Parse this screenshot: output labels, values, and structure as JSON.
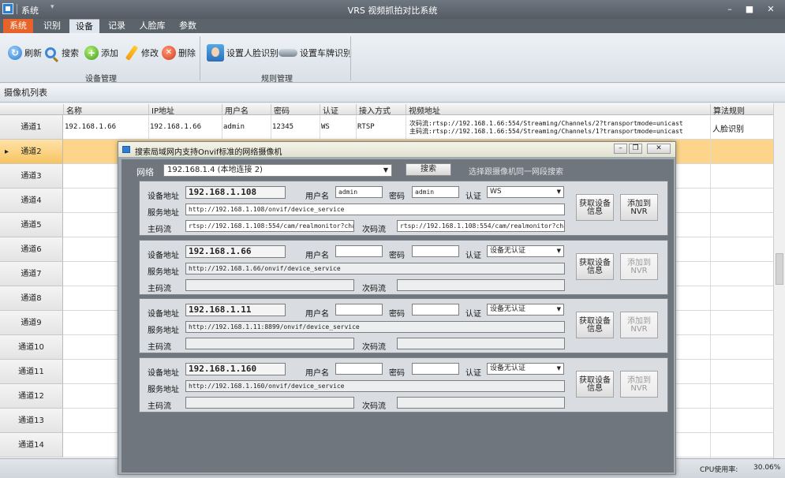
{
  "window": {
    "system_label": "系统",
    "title": "VRS 视频抓拍对比系统",
    "min": "–",
    "max": "■",
    "close": "✕"
  },
  "menu_tabs": [
    "系统",
    "识别",
    "设备",
    "记录",
    "人脸库",
    "参数"
  ],
  "ribbon": {
    "buttons": [
      "刷新",
      "搜索",
      "添加",
      "修改",
      "删除",
      "设置人脸识别",
      "设置车牌识别"
    ],
    "groups": [
      "设备管理",
      "规则管理"
    ]
  },
  "panel_title": "摄像机列表",
  "grid": {
    "columns": [
      "名称",
      "IP地址",
      "用户名",
      "密码",
      "认证",
      "接入方式",
      "视频地址",
      "算法规则"
    ],
    "row_labels": [
      "通道1",
      "通道2",
      "通道3",
      "通道4",
      "通道5",
      "通道6",
      "通道7",
      "通道8",
      "通道9",
      "通道10",
      "通道11",
      "通道12",
      "通道13",
      "通道14"
    ],
    "row1": {
      "name": "192.168.1.66",
      "ip": "192.168.1.66",
      "user": "admin",
      "password": "12345",
      "auth": "WS",
      "access": "RTSP",
      "sub_stream": "次码流:rtsp://192.168.1.66:554/Streaming/Channels/2?transportmode=unicast",
      "main_stream": "主码流:rtsp://192.168.1.66:554/Streaming/Channels/1?transportmode=unicast",
      "rule": "人脸识别"
    },
    "selected_row": "通道2"
  },
  "status": {
    "cpu_label": "CPU使用率:",
    "cpu_value": "30.06%"
  },
  "dialog": {
    "title": "搜索局域网内支持Onvif标准的网络摄像机",
    "network_label": "网络",
    "network_value": "192.168.1.4 (本地连接 2)",
    "search_button": "搜索",
    "hint": "选择跟摄像机同一网段搜索",
    "labels": {
      "device_addr": "设备地址",
      "service_addr": "服务地址",
      "main_stream": "主码流",
      "sub_stream": "次码流",
      "username": "用户名",
      "password": "密码",
      "auth": "认证",
      "get_info": "获取设备信息",
      "add_nvr": "添加到NVR"
    },
    "devices": [
      {
        "ip": "192.168.1.108",
        "user": "admin",
        "password": "admin",
        "auth": "WS",
        "service": "http://192.168.1.108/onvif/device_service",
        "main": "rtsp://192.168.1.108:554/cam/realmonitor?chan",
        "sub": "rtsp://192.168.1.108:554/cam/realmonitor?chan"
      },
      {
        "ip": "192.168.1.66",
        "user": "",
        "password": "",
        "auth": "设备无认证",
        "service": "http://192.168.1.66/onvif/device_service",
        "main": "",
        "sub": ""
      },
      {
        "ip": "192.168.1.11",
        "user": "",
        "password": "",
        "auth": "设备无认证",
        "service": "http://192.168.1.11:8899/onvif/device_service",
        "main": "",
        "sub": ""
      },
      {
        "ip": "192.168.1.160",
        "user": "",
        "password": "",
        "auth": "设备无认证",
        "service": "http://192.168.1.160/onvif/device_service",
        "main": "",
        "sub": ""
      }
    ]
  }
}
